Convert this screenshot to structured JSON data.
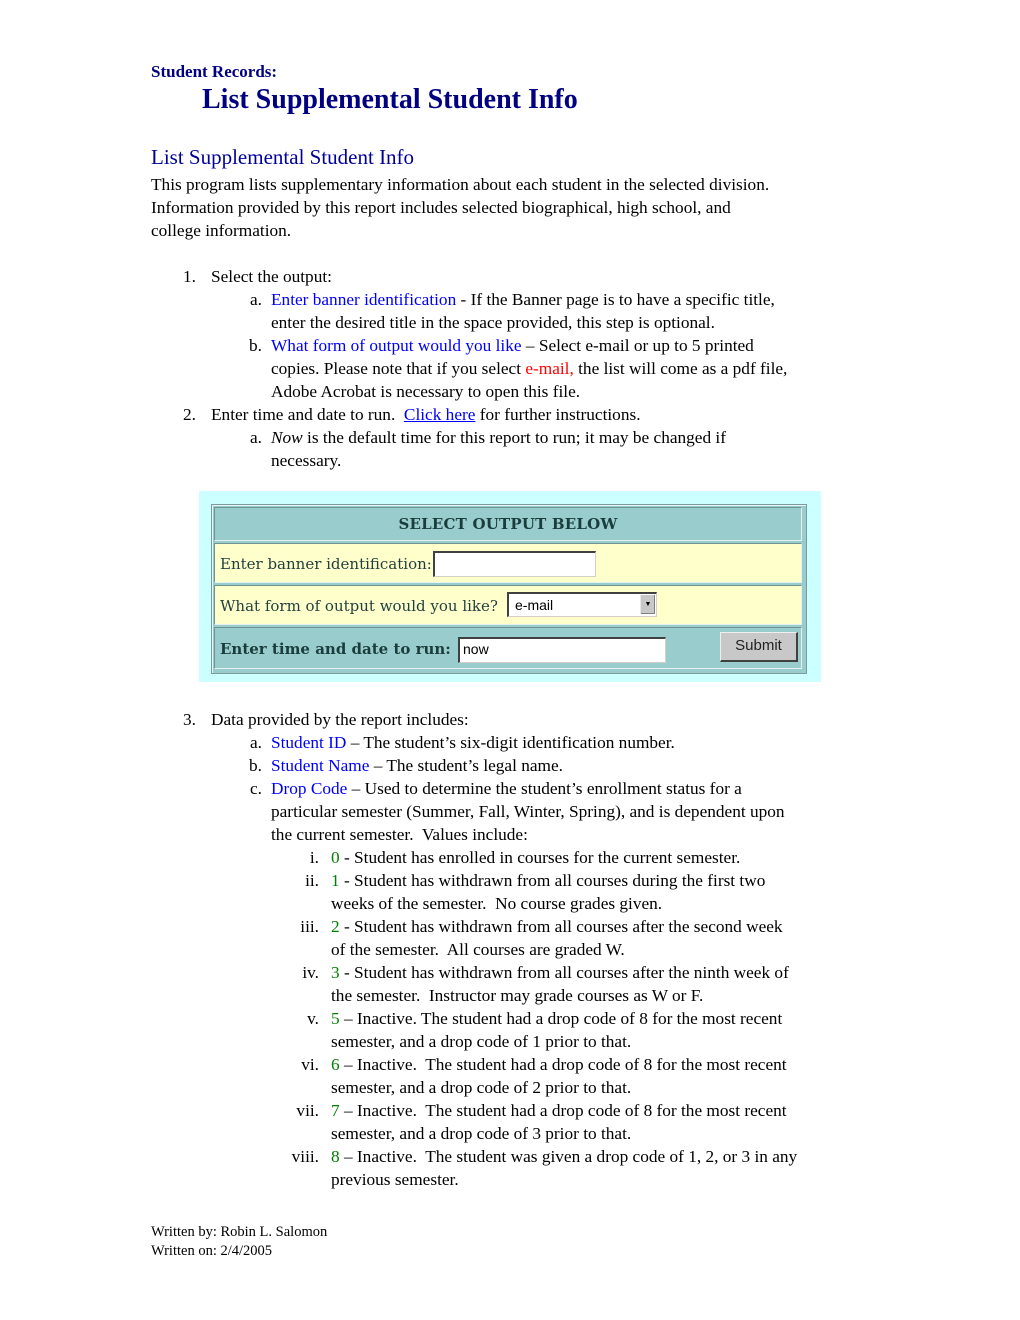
{
  "header": {
    "section_label": "Student Records:",
    "page_title": "List Supplemental Student Info"
  },
  "intro": {
    "heading": "List Supplemental Student Info",
    "lines": [
      "This program lists supplementary information about each student in the selected division.",
      "Information provided by this report includes selected biographical, high school, and",
      "college information."
    ]
  },
  "steps": {
    "step1": {
      "number": "1.",
      "text": "Select the output:",
      "a": {
        "marker": "a.",
        "term": "Enter banner identification",
        "line1_rest": " - If the Banner page is to have a specific title,",
        "line2": "enter the desired title in the space provided, this step is optional."
      },
      "b": {
        "marker": "b.",
        "term": "What form of output would you like",
        "line1_rest": " – Select e-mail or up to 5 printed",
        "line2_pre": "copies. Please note that if you select ",
        "line2_highlight": "e-mail,",
        "line2_post": " the list will come as a pdf file,",
        "line3": "Adobe Acrobat is necessary to open this file."
      }
    },
    "step2": {
      "number": "2.",
      "text_pre": "Enter time and date to run.  ",
      "link": "Click here",
      "text_post": " for further instructions.",
      "a": {
        "marker": "a.",
        "em": "Now",
        "line1_rest": " is the default time for this report to run; it may be changed if",
        "line2": "necessary."
      }
    },
    "step3": {
      "number": "3.",
      "text": "Data provided by the report includes:",
      "a": {
        "marker": "a.",
        "term": "Student ID",
        "rest": " – The student’s six-digit identification number."
      },
      "b": {
        "marker": "b.",
        "term": "Student Name",
        "rest": " – The student’s legal name."
      },
      "c": {
        "marker": "c.",
        "term": "Drop Code",
        "line1_rest": " – Used to determine the student’s enrollment status for a",
        "line2": "particular semester (Summer, Fall, Winter, Spring), and is dependent upon",
        "line3": "the current semester.  Values include:"
      },
      "drop_codes": [
        {
          "marker": "i.",
          "code": "0",
          "line1": " - Student has enrolled in courses for the current semester.",
          "line2": ""
        },
        {
          "marker": "ii.",
          "code": "1",
          "line1": " - Student has withdrawn from all courses during the first two",
          "line2": "weeks of the semester.  No course grades given."
        },
        {
          "marker": "iii.",
          "code": "2",
          "line1": " - Student has withdrawn from all courses after the second week",
          "line2": "of the semester.  All courses are graded W."
        },
        {
          "marker": "iv.",
          "code": "3",
          "line1": " - Student has withdrawn from all courses after the ninth week of",
          "line2": "the semester.  Instructor may grade courses as W or F."
        },
        {
          "marker": "v.",
          "code": "5",
          "line1": " – Inactive. The student had a drop code of 8 for the most recent",
          "line2": "semester, and a drop code of 1 prior to that."
        },
        {
          "marker": "vi.",
          "code": "6",
          "line1": " – Inactive.  The student had a drop code of 8 for the most recent",
          "line2": "semester, and a drop code of 2 prior to that."
        },
        {
          "marker": "vii.",
          "code": "7",
          "line1": " – Inactive.  The student had a drop code of 8 for the most recent",
          "line2": "semester, and a drop code of 3 prior to that."
        },
        {
          "marker": "viii.",
          "code": "8",
          "line1": " – Inactive.  The student was given a drop code of 1, 2, or 3 in any",
          "line2": "previous semester."
        }
      ]
    }
  },
  "form": {
    "header": "SELECT OUTPUT BELOW",
    "banner_label": "Enter banner identification:",
    "banner_value": "",
    "output_label": "What form of output would you like?",
    "output_selected": "e-mail",
    "time_label": "Enter time and date to run:",
    "time_value": "now",
    "submit_label": "Submit"
  },
  "footer": {
    "written_by": "Written by: Robin L. Salomon",
    "written_on": "Written on: 2/4/2005"
  },
  "colors": {
    "title": "#000080",
    "term": "#0000ff",
    "highlight": "#ff0000",
    "code": "#008000",
    "form_bg": "#ccffff",
    "form_header": "#99cccc",
    "form_row": "#ffffcc"
  }
}
